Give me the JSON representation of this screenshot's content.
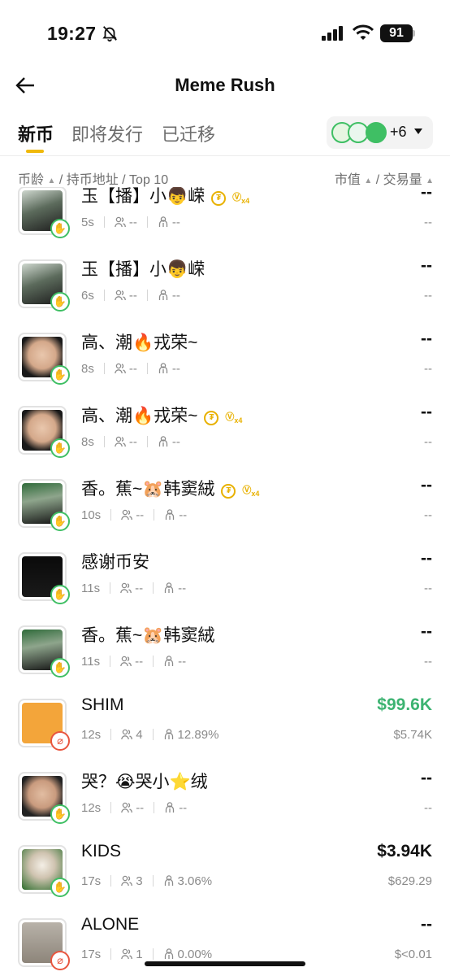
{
  "status": {
    "time": "19:27",
    "battery": "91"
  },
  "header": {
    "title": "Meme Rush"
  },
  "tabs": [
    {
      "label": "新币",
      "active": true
    },
    {
      "label": "即将发行",
      "active": false
    },
    {
      "label": "已迁移",
      "active": false
    }
  ],
  "filter": {
    "more": "+6"
  },
  "sort": {
    "left": [
      "币龄",
      "/ 持币地址 / Top 10"
    ],
    "right": [
      "市值",
      "/ 交易量"
    ]
  },
  "rows": [
    {
      "name": "玉【播】小👦嵘",
      "age": "5s",
      "holders": "--",
      "top10": "--",
      "mcap": "--",
      "vol": "--",
      "badge": "hand",
      "tags": true
    },
    {
      "name": "玉【播】小👦嵘",
      "age": "6s",
      "holders": "--",
      "top10": "--",
      "mcap": "--",
      "vol": "--",
      "badge": "hand",
      "tags": false
    },
    {
      "name": "高、潮🔥戎荣~",
      "age": "8s",
      "holders": "--",
      "top10": "--",
      "mcap": "--",
      "vol": "--",
      "badge": "hand",
      "tags": false
    },
    {
      "name": "高、潮🔥戎荣~",
      "age": "8s",
      "holders": "--",
      "top10": "--",
      "mcap": "--",
      "vol": "--",
      "badge": "hand",
      "tags": true
    },
    {
      "name": "香。蕉~🐹韩窦絨",
      "age": "10s",
      "holders": "--",
      "top10": "--",
      "mcap": "--",
      "vol": "--",
      "badge": "hand",
      "tags": true
    },
    {
      "name": "感谢币安",
      "age": "11s",
      "holders": "--",
      "top10": "--",
      "mcap": "--",
      "vol": "--",
      "badge": "hand",
      "tags": false
    },
    {
      "name": "香。蕉~🐹韩窦絨",
      "age": "11s",
      "holders": "--",
      "top10": "--",
      "mcap": "--",
      "vol": "--",
      "badge": "hand",
      "tags": false
    },
    {
      "name": "SHIM",
      "age": "12s",
      "holders": "4",
      "top10": "12.89%",
      "mcap": "$99.6K",
      "vol": "$5.74K",
      "badge": "pill",
      "tags": false,
      "green": true
    },
    {
      "name": "哭？😭哭小⭐绒",
      "age": "12s",
      "holders": "--",
      "top10": "--",
      "mcap": "--",
      "vol": "--",
      "badge": "hand",
      "tags": false
    },
    {
      "name": "KIDS",
      "age": "17s",
      "holders": "3",
      "top10": "3.06%",
      "mcap": "$3.94K",
      "vol": "$629.29",
      "badge": "hand",
      "tags": false
    },
    {
      "name": "ALONE",
      "age": "17s",
      "holders": "1",
      "top10": "0.00%",
      "mcap": "--",
      "vol": "$<0.01",
      "badge": "pill",
      "tags": false
    }
  ],
  "colors": {
    "accent": "#f0b90b",
    "green": "#3cb371",
    "badgeGreen": "#3fbf64",
    "tagGold": "#e8b100"
  }
}
